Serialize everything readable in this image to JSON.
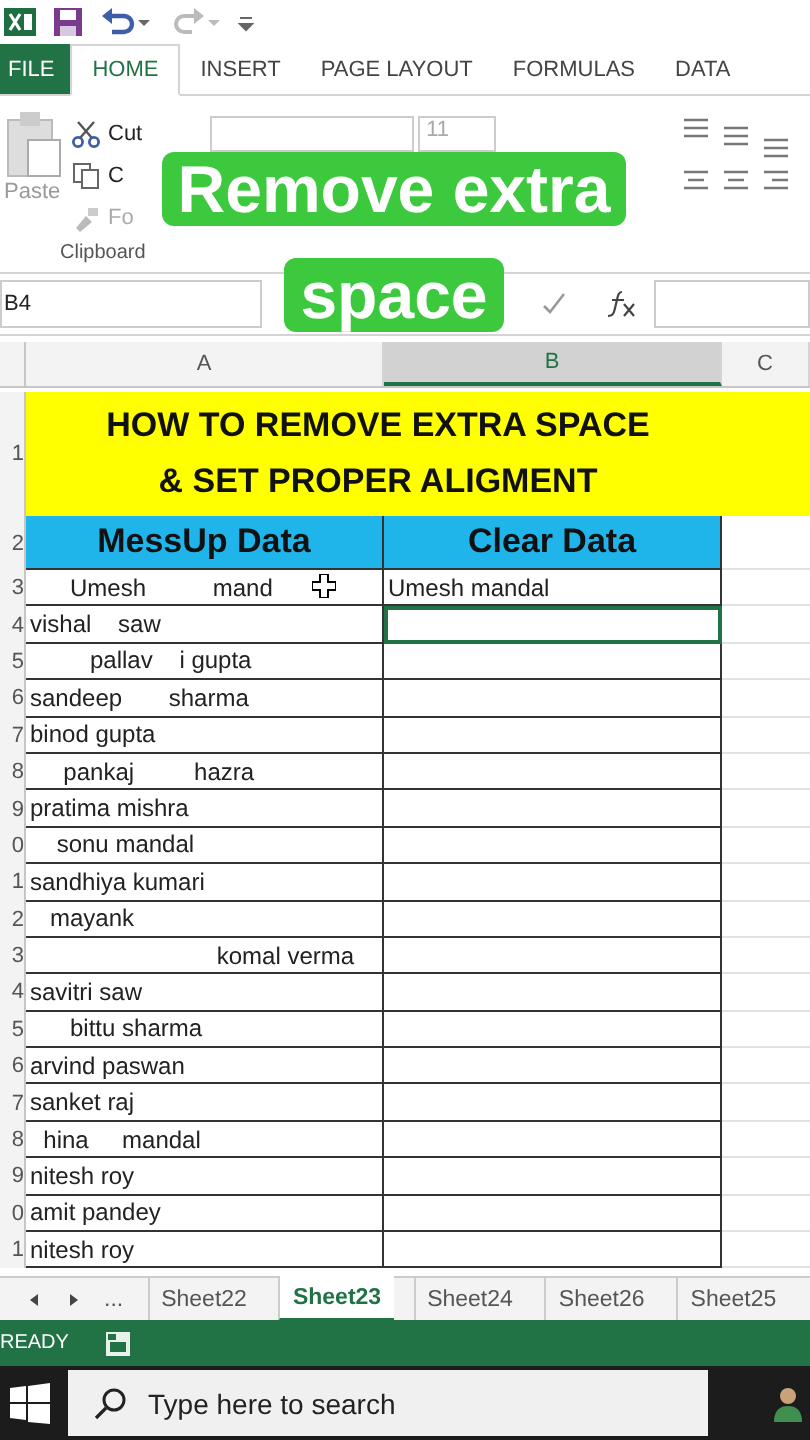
{
  "ribbon": {
    "tabs": [
      {
        "label": "FILE",
        "kind": "file",
        "selected": false
      },
      {
        "label": "HOME",
        "kind": "tab",
        "selected": true
      },
      {
        "label": "INSERT",
        "kind": "tab",
        "selected": false
      },
      {
        "label": "PAGE LAYOUT",
        "kind": "tab",
        "selected": false
      },
      {
        "label": "FORMULAS",
        "kind": "tab",
        "selected": false
      },
      {
        "label": "DATA",
        "kind": "tab",
        "selected": false
      }
    ],
    "clipboard": {
      "paste": "Paste",
      "cut": "Cut",
      "copy": "C",
      "format_painter": "Fo",
      "group_label": "Clipboard"
    },
    "font_size": "11"
  },
  "caption": "Remove extra space",
  "formula_bar": {
    "name_box": "B4"
  },
  "sheet": {
    "columns": [
      {
        "label": "A",
        "selected": false
      },
      {
        "label": "B",
        "selected": true
      },
      {
        "label": "C",
        "selected": false
      }
    ],
    "title_row_number": "1",
    "title_lines": [
      "HOW TO REMOVE EXTRA SPACE",
      "& SET PROPER ALIGMENT"
    ],
    "header_row_number": "2",
    "headers": [
      "MessUp Data",
      "Clear Data"
    ],
    "rows": [
      {
        "number": "3",
        "a": "      Umesh          mand",
        "b": "Umesh mandal",
        "selected": false
      },
      {
        "number": "4",
        "a": "vishal    saw",
        "b": "",
        "selected": true
      },
      {
        "number": "5",
        "a": "         pallav    i gupta",
        "b": "",
        "selected": false
      },
      {
        "number": "6",
        "a": "sandeep       sharma",
        "b": "",
        "selected": false
      },
      {
        "number": "7",
        "a": "binod gupta",
        "b": "",
        "selected": false
      },
      {
        "number": "8",
        "a": "     pankaj         hazra",
        "b": "",
        "selected": false
      },
      {
        "number": "9",
        "a": "pratima mishra",
        "b": "",
        "selected": false
      },
      {
        "number": "0",
        "a": "    sonu mandal",
        "b": "",
        "selected": false
      },
      {
        "number": "1",
        "a": "sandhiya kumari",
        "b": "",
        "selected": false
      },
      {
        "number": "2",
        "a": "   mayank",
        "b": "",
        "selected": false
      },
      {
        "number": "3",
        "a": "                            komal verma",
        "b": "",
        "selected": false
      },
      {
        "number": "4",
        "a": "savitri saw",
        "b": "",
        "selected": false
      },
      {
        "number": "5",
        "a": "      bittu sharma",
        "b": "",
        "selected": false
      },
      {
        "number": "6",
        "a": "arvind paswan",
        "b": "",
        "selected": false
      },
      {
        "number": "7",
        "a": "sanket raj",
        "b": "",
        "selected": false
      },
      {
        "number": "8",
        "a": "  hina     mandal",
        "b": "",
        "selected": false
      },
      {
        "number": "9",
        "a": "nitesh roy",
        "b": "",
        "selected": false
      },
      {
        "number": "0",
        "a": "amit pandey",
        "b": "",
        "selected": false
      },
      {
        "number": "1",
        "a": "nitesh roy",
        "b": "",
        "selected": false
      }
    ]
  },
  "sheet_tabs": {
    "more": "...",
    "tabs": [
      {
        "label": "Sheet22",
        "selected": false
      },
      {
        "label": "Sheet23",
        "selected": true
      },
      {
        "label": "Sheet24",
        "selected": false
      },
      {
        "label": "Sheet26",
        "selected": false
      },
      {
        "label": "Sheet25",
        "selected": false
      }
    ]
  },
  "status_bar": {
    "mode": "READY"
  },
  "taskbar": {
    "search_placeholder": "Type here to search"
  }
}
